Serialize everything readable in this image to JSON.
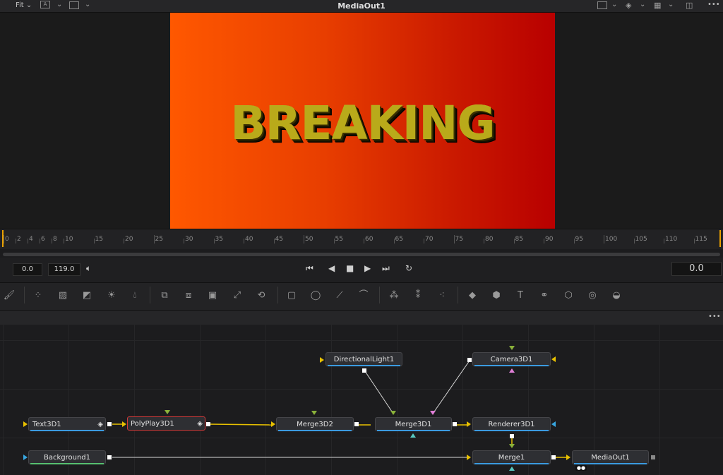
{
  "topbar": {
    "fit_label": "Fit",
    "title": "MediaOut1",
    "more_label": "•••"
  },
  "viewer": {
    "text": "BREAKING"
  },
  "ruler": {
    "labels": [
      "0",
      "2",
      "4",
      "6",
      "8",
      "10",
      "15",
      "20",
      "25",
      "30",
      "35",
      "40",
      "45",
      "50",
      "55",
      "60",
      "65",
      "70",
      "75",
      "80",
      "85",
      "90",
      "95",
      "100",
      "105",
      "110",
      "115"
    ]
  },
  "transport": {
    "start_value": "0.0",
    "end_value": "119.0",
    "current_time": "0.0"
  },
  "node_editor": {
    "more_label": "•••",
    "nodes": {
      "text3d": "Text3D1",
      "polyplay3d": "PolyPlay3D1",
      "merge3d2": "Merge3D2",
      "merge3d1": "Merge3D1",
      "renderer3d": "Renderer3D1",
      "directional_light": "DirectionalLight1",
      "camera3d": "Camera3D1",
      "background": "Background1",
      "merge1": "Merge1",
      "mediaout": "MediaOut1"
    }
  },
  "colors": {
    "frame_left": "#ff5800",
    "frame_right": "#b80000",
    "text": "#b9aa1a",
    "yellow_connector": "#e8c100",
    "blue_connector": "#38a6e0",
    "green_connector": "#8bb23a"
  }
}
